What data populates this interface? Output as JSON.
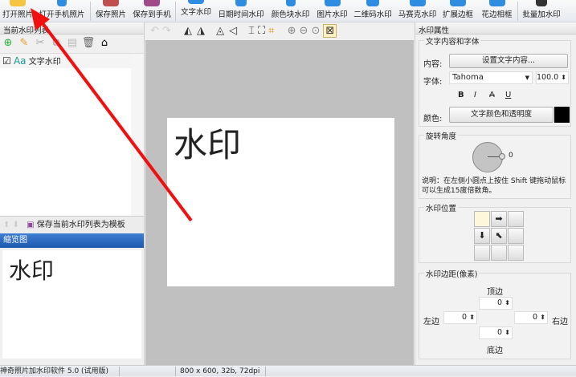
{
  "toolbar": {
    "items": [
      "打开照片",
      "打开手机照片",
      "保存照片",
      "保存到手机",
      "文字水印",
      "日期时间水印",
      "颜色块水印",
      "图片水印",
      "二维码水印",
      "马赛克水印",
      "扩展边框",
      "花边相框",
      "批量加水印"
    ]
  },
  "left": {
    "title": "当前水印列表",
    "items": [
      {
        "label": "文字水印",
        "checked": true,
        "icon": "Aa"
      }
    ],
    "save_template": "保存当前水印列表为模板",
    "thumb_title": "缩览图",
    "thumb_text": "水印"
  },
  "canvas": {
    "watermark_text": "水印"
  },
  "right": {
    "title": "水印属性",
    "text_group": "文字内容和字体",
    "content_label": "内容:",
    "content_btn": "设置文字内容...",
    "font_label": "字体:",
    "font_value": "Tahoma",
    "size_value": "100.0",
    "style_bold": "B",
    "style_italic": "I",
    "style_strike": "A",
    "style_underline": "U",
    "color_label": "颜色:",
    "color_btn": "文字颜色和透明度",
    "color_value": "#000000",
    "rotate_group": "旋转角度",
    "rotate_value": "0",
    "rotate_note": "说明：在左侧小圆点上按住 Shift 键拖动鼠标可以生成15度倍数角。",
    "position_group": "水印位置",
    "margin_group": "水印边距(像素)",
    "top_label": "顶边",
    "bottom_label": "底边",
    "left_label": "左边",
    "right_label": "右边",
    "top": "0",
    "bottom": "0",
    "left": "0",
    "right": "0"
  },
  "status": {
    "app": "神奇照片加水印软件 5.0 (试用版)",
    "image_info": "800 x 600, 32b, 72dpi"
  }
}
